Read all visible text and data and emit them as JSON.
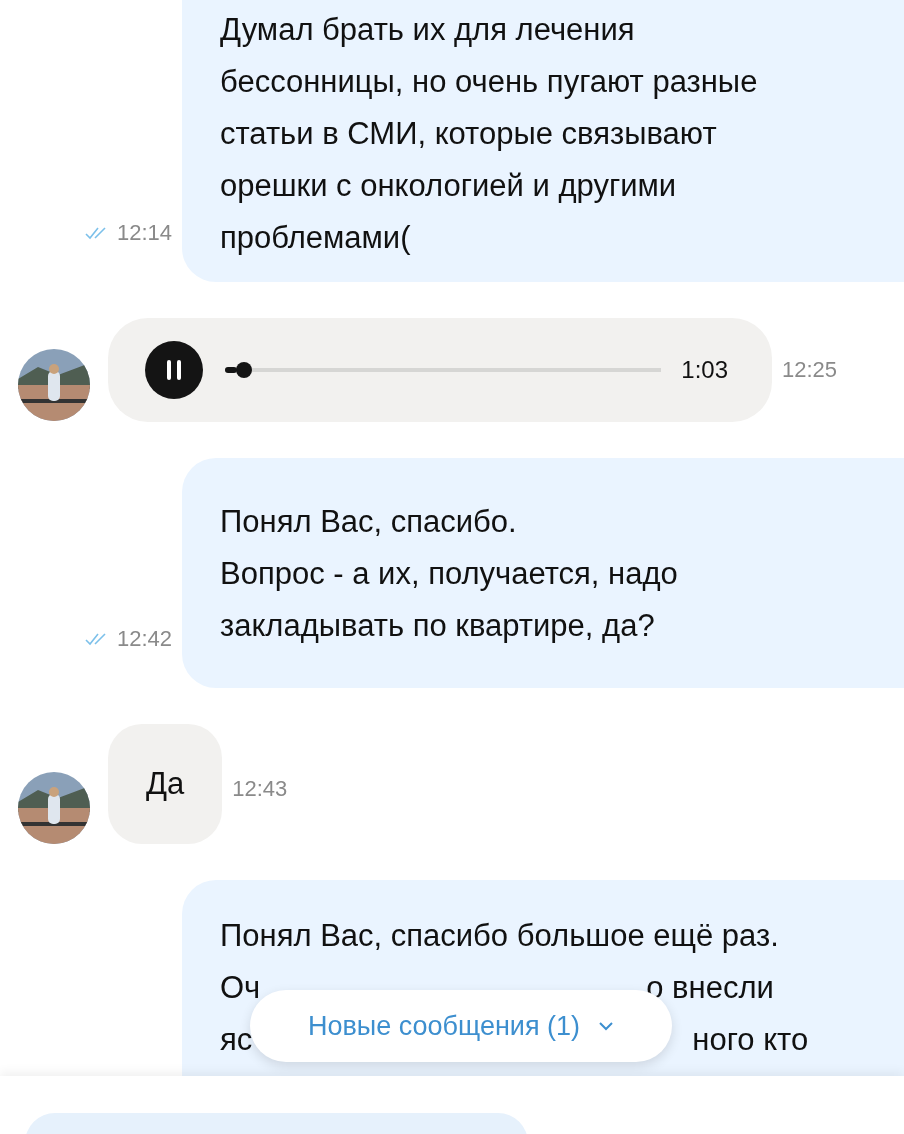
{
  "messages": [
    {
      "kind": "outgoing",
      "lines": [
        [
          "Думал брать их для лечения"
        ],
        [
          "бессонницы, но очень пугают разные"
        ],
        [
          "статьи в СМИ, которые связывают"
        ],
        [
          "орешки с онкологией и другими"
        ],
        [
          "проблемами("
        ]
      ],
      "time": "12:14",
      "read": true
    },
    {
      "kind": "voice",
      "duration": "1:03",
      "level": 0.02,
      "playing": true,
      "time": "12:25"
    },
    {
      "kind": "outgoing",
      "lines": [
        [
          "Понял Вас, спасибо."
        ],
        [
          "Вопрос - а их, получается, надо"
        ],
        [
          "закладывать по квартире, да?"
        ]
      ],
      "time": "12:42",
      "read": true
    },
    {
      "kind": "incoming",
      "lines": [
        [
          "Да"
        ]
      ],
      "time": "12:43"
    },
    {
      "kind": "outgoing",
      "lines": [
        [
          "Понял Вас, спасибо большое ещё раз."
        ],
        [
          "Оч",
          "о внесли"
        ],
        [
          "яс",
          "ного кто"
        ]
      ]
    }
  ],
  "new_messages_button": {
    "label": "Новые сообщения (1)"
  }
}
